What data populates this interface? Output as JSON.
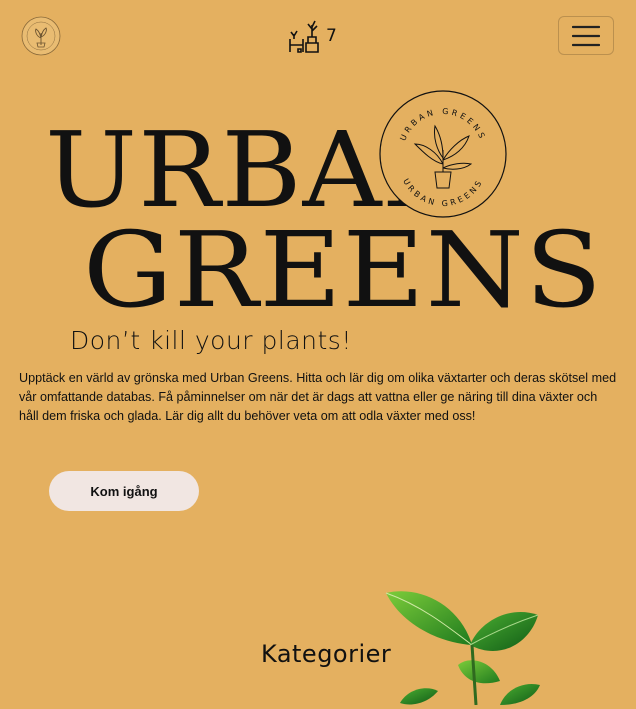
{
  "nav": {
    "logo_name": "urban-greens-logo",
    "cart_count": "7",
    "menu_icon": "hamburger-icon"
  },
  "hero": {
    "title_line1": "URBAN",
    "title_line2": "GREENS",
    "badge_text_top": "URBAN GREENS",
    "badge_text_bottom": "URBAN GREENS",
    "tagline": "Don’t kill your plants!",
    "intro": "Upptäck en värld av grönska med Urban Greens. Hitta och lär dig om olika växtarter och deras skötsel med vår omfattande databas. Få påminnelser om när det är dags att vattna eller ge näring till dina växter och håll dem friska och glada. Lär dig allt du behöver veta om att odla växter med oss!",
    "cta_label": "Kom igång"
  },
  "categories": {
    "title": "Kategorier"
  },
  "colors": {
    "background": "#e4b060",
    "button_bg": "#f1e6e2",
    "text": "#111111"
  }
}
